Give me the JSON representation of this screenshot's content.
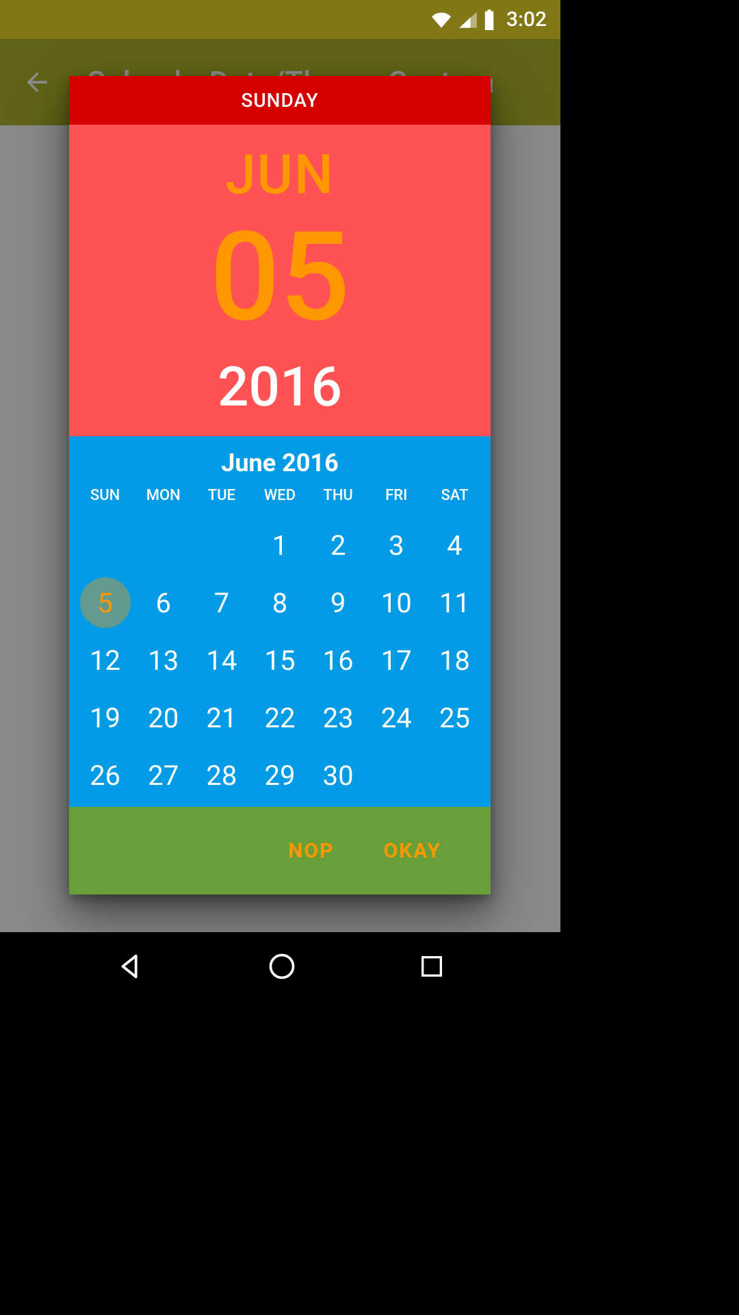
{
  "status": {
    "time": "3:02"
  },
  "toolbar": {
    "title": "CalendarDate/Theme Custom"
  },
  "picker": {
    "dayname": "SUNDAY",
    "month_short": "JUN",
    "day": "05",
    "year": "2016",
    "month_title": "June 2016",
    "dow": [
      "SUN",
      "MON",
      "TUE",
      "WED",
      "THU",
      "FRI",
      "SAT"
    ],
    "selected_day": 5,
    "first_day_col": 3,
    "days_in_month": 30
  },
  "actions": {
    "cancel": "NOP",
    "ok": "OKAY"
  }
}
